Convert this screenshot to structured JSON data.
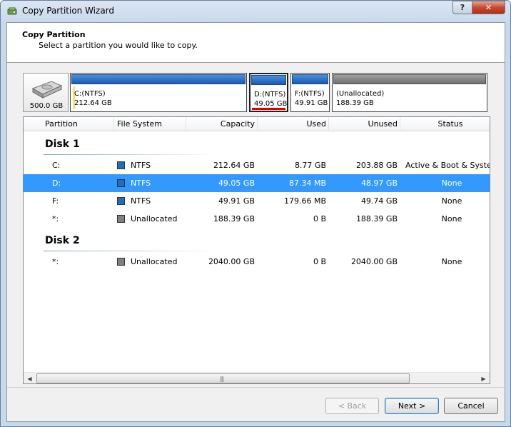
{
  "window": {
    "title": "Copy Partition Wizard",
    "help_label": "?",
    "close_label": "✕"
  },
  "header": {
    "title": "Copy Partition",
    "subtitle": "Select a partition you would like to copy."
  },
  "diskmap": {
    "disk_size": "500.0 GB",
    "partitions": [
      {
        "line1": "C:(NTFS)",
        "line2": "212.64 GB"
      },
      {
        "line1": "D:(NTFS)",
        "line2": "49.05 GB"
      },
      {
        "line1": "F:(NTFS)",
        "line2": "49.91 GB"
      },
      {
        "line1": "(Unallocated)",
        "line2": "188.39 GB"
      }
    ]
  },
  "table": {
    "columns": [
      "Partition",
      "File System",
      "Capacity",
      "Used",
      "Unused",
      "Status"
    ],
    "groups": [
      {
        "name": "Disk 1",
        "rows": [
          {
            "partition": "C:",
            "fs": "NTFS",
            "capacity": "212.64 GB",
            "used": "8.77 GB",
            "unused": "203.88 GB",
            "status": "Active & Boot & System"
          },
          {
            "partition": "D:",
            "fs": "NTFS",
            "capacity": "49.05 GB",
            "used": "87.34 MB",
            "unused": "48.97 GB",
            "status": "None"
          },
          {
            "partition": "F:",
            "fs": "NTFS",
            "capacity": "49.91 GB",
            "used": "179.66 MB",
            "unused": "49.74 GB",
            "status": "None"
          },
          {
            "partition": "*:",
            "fs": "Unallocated",
            "capacity": "188.39 GB",
            "used": "0 B",
            "unused": "188.39 GB",
            "status": "None"
          }
        ]
      },
      {
        "name": "Disk 2",
        "rows": [
          {
            "partition": "*:",
            "fs": "Unallocated",
            "capacity": "2040.00 GB",
            "used": "0 B",
            "unused": "2040.00 GB",
            "status": "None"
          }
        ]
      }
    ]
  },
  "colors": {
    "ntfs": "#1e6fc0",
    "unallocated": "#808080",
    "selection": "#3399ff",
    "used_marker": "#e00000"
  },
  "buttons": {
    "back": "< Back",
    "next": "Next >",
    "cancel": "Cancel"
  }
}
